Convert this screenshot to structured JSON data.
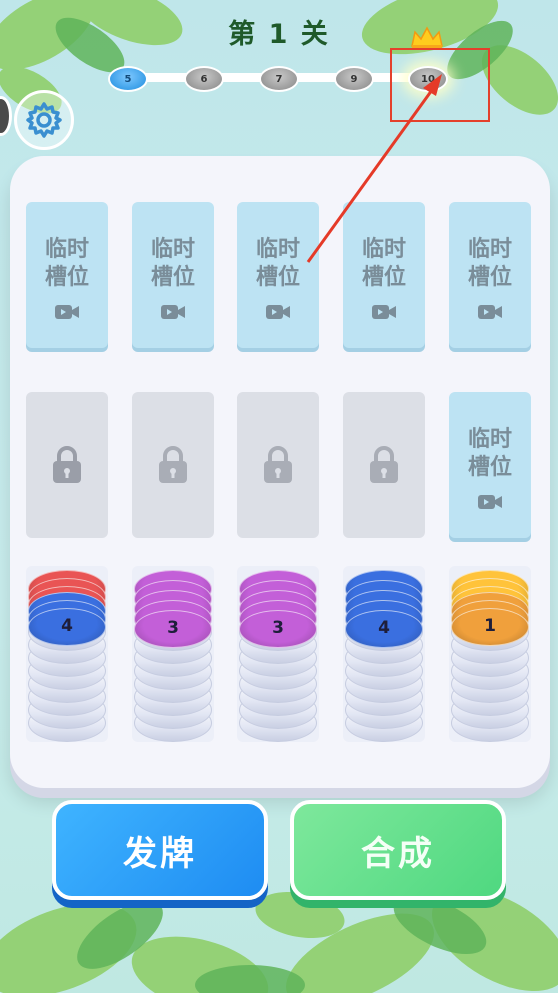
{
  "header": {
    "title": "第 1 关"
  },
  "levels": [
    {
      "label": "5",
      "state": "current"
    },
    {
      "label": "6",
      "state": "locked"
    },
    {
      "label": "7",
      "state": "locked"
    },
    {
      "label": "9",
      "state": "locked"
    },
    {
      "label": "10",
      "state": "target"
    }
  ],
  "temp_slot_label_line1": "临时",
  "temp_slot_label_line2": "槽位",
  "top_slots": [
    {
      "type": "temp"
    },
    {
      "type": "temp"
    },
    {
      "type": "temp"
    },
    {
      "type": "temp"
    },
    {
      "type": "temp"
    }
  ],
  "middle_slots": [
    {
      "type": "locked"
    },
    {
      "type": "locked"
    },
    {
      "type": "locked"
    },
    {
      "type": "locked"
    },
    {
      "type": "temp"
    }
  ],
  "stacks": [
    {
      "top_number": "4",
      "colors": [
        "#e95454",
        "#3a6fe0"
      ]
    },
    {
      "top_number": "3",
      "colors": [
        "#c35fd8"
      ]
    },
    {
      "top_number": "3",
      "colors": [
        "#c35fd8"
      ]
    },
    {
      "top_number": "4",
      "colors": [
        "#3a6fe0"
      ]
    },
    {
      "top_number": "1",
      "colors": [
        "#ffc33a",
        "#f0a03c"
      ]
    }
  ],
  "buttons": {
    "deal": "发牌",
    "merge": "合成"
  },
  "icons": {
    "settings": "gear-icon",
    "lock": "lock-icon",
    "video": "video-icon",
    "crown": "crown-icon"
  }
}
